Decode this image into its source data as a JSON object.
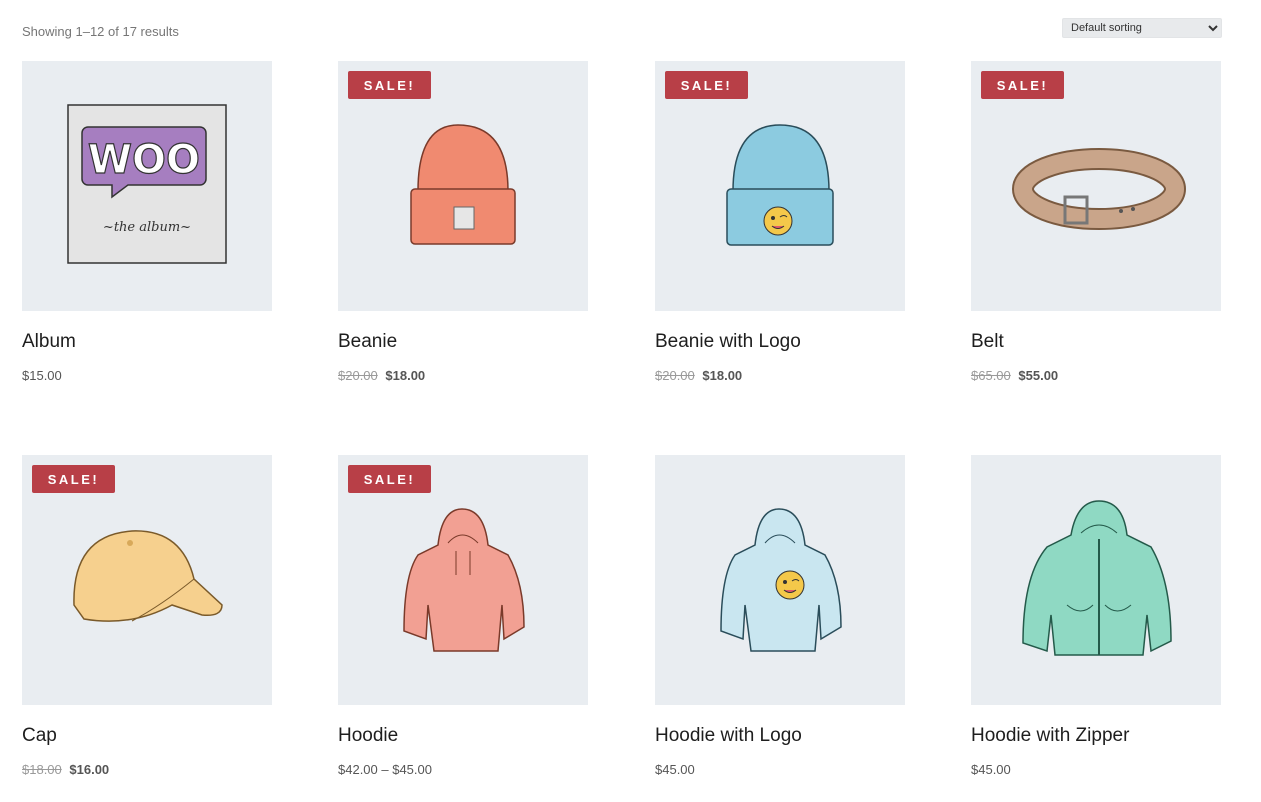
{
  "toolbar": {
    "result_count": "Showing 1–12 of 17 results",
    "sorting": {
      "selected": "Default sorting"
    }
  },
  "sale_badge": "SALE!",
  "products": [
    {
      "name": "Album",
      "price": "$15.00",
      "icon": "album-icon"
    },
    {
      "name": "Beanie",
      "regular_price": "$20.00",
      "sale_price": "$18.00",
      "icon": "beanie-icon",
      "on_sale": true
    },
    {
      "name": "Beanie with Logo",
      "regular_price": "$20.00",
      "sale_price": "$18.00",
      "icon": "beanie-with-logo-icon",
      "on_sale": true
    },
    {
      "name": "Belt",
      "regular_price": "$65.00",
      "sale_price": "$55.00",
      "icon": "belt-icon",
      "on_sale": true
    },
    {
      "name": "Cap",
      "regular_price": "$18.00",
      "sale_price": "$16.00",
      "icon": "cap-icon",
      "on_sale": true
    },
    {
      "name": "Hoodie",
      "price": "$42.00 – $45.00",
      "icon": "hoodie-icon",
      "on_sale": true
    },
    {
      "name": "Hoodie with Logo",
      "price": "$45.00",
      "icon": "hoodie-with-logo-icon"
    },
    {
      "name": "Hoodie with Zipper",
      "price": "$45.00",
      "icon": "hoodie-with-zipper-icon"
    }
  ],
  "colors": {
    "sale_badge": "#b83f47",
    "thumb_background": "#e9edf1",
    "beanie": "#f08a70",
    "beanie_logo": "#8ccbe0",
    "belt": "#c9a58a",
    "cap": "#f6d08e",
    "hoodie": "#f2a093",
    "hoodie_logo": "#c9e6f0",
    "hoodie_zipper": "#8fd9c3",
    "album_purple": "#a67ec0"
  }
}
